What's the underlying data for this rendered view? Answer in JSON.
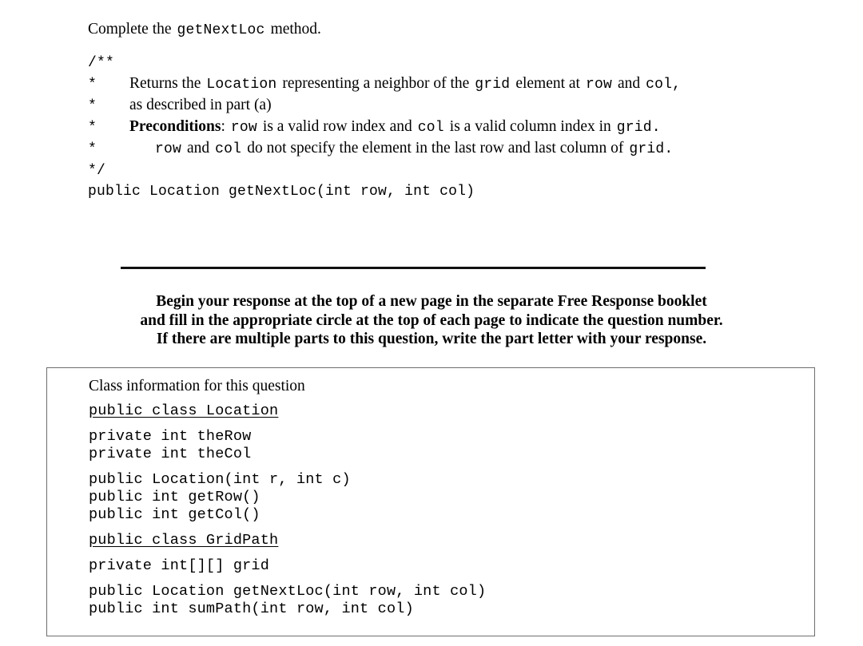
{
  "document": {
    "intro": {
      "before": "Complete the",
      "method": "getNextLoc",
      "after": "method."
    },
    "javadoc": {
      "open": "/**",
      "close": " */",
      "lines": [
        {
          "indent": "a",
          "segments": [
            {
              "type": "serif",
              "text": "Returns the"
            },
            {
              "type": "mono",
              "text": "Location"
            },
            {
              "type": "serif",
              "text": "representing a neighbor of the"
            },
            {
              "type": "mono",
              "text": "grid"
            },
            {
              "type": "serif",
              "text": "element at"
            },
            {
              "type": "mono",
              "text": "row"
            },
            {
              "type": "serif",
              "text": "and"
            },
            {
              "type": "mono",
              "text": "col,"
            }
          ]
        },
        {
          "indent": "a",
          "segments": [
            {
              "type": "serif",
              "text": "as described in part (a)"
            }
          ]
        },
        {
          "indent": "a",
          "segments": [
            {
              "type": "serif-bold",
              "text": "Preconditions"
            },
            {
              "type": "serif-tight",
              "text": ":"
            },
            {
              "type": "mono",
              "text": "row"
            },
            {
              "type": "serif",
              "text": "is a valid row index and"
            },
            {
              "type": "mono",
              "text": "col"
            },
            {
              "type": "serif",
              "text": "is a valid column index in"
            },
            {
              "type": "mono",
              "text": "grid."
            }
          ]
        },
        {
          "indent": "b",
          "segments": [
            {
              "type": "mono",
              "text": "row"
            },
            {
              "type": "serif",
              "text": "and"
            },
            {
              "type": "mono",
              "text": "col"
            },
            {
              "type": "serif",
              "text": "do not specify the element in the last row and last column of"
            },
            {
              "type": "mono",
              "text": "grid."
            }
          ]
        }
      ],
      "star": "*"
    },
    "signature": "public Location getNextLoc(int row, int col)",
    "instructions": [
      "Begin your response at the top of a new page in the separate Free Response booklet",
      "and fill in the appropriate circle at the top of each page to indicate the question number.",
      "If there are multiple parts to this question, write the part letter with your response."
    ],
    "class_box": {
      "heading": "Class information for this question",
      "border_color": "#6e6e6e",
      "groups": [
        {
          "underlined": true,
          "lines": [
            "public class Location"
          ]
        },
        {
          "underlined": false,
          "lines": [
            "private int theRow",
            "private int theCol"
          ]
        },
        {
          "underlined": false,
          "lines": [
            "public Location(int r, int c)",
            "public int getRow()",
            "public int getCol()"
          ]
        },
        {
          "underlined": true,
          "lines": [
            "public class GridPath"
          ]
        },
        {
          "underlined": false,
          "lines": [
            "private int[][] grid"
          ]
        },
        {
          "underlined": false,
          "lines": [
            "public Location getNextLoc(int row, int col)",
            "public int sumPath(int row, int col)"
          ]
        }
      ]
    }
  }
}
